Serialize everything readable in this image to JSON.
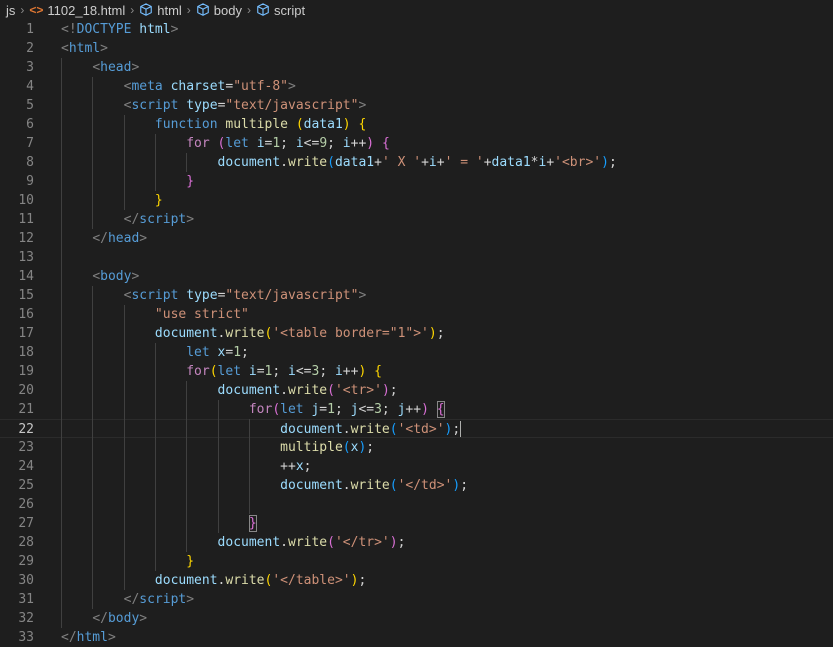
{
  "breadcrumb": {
    "folder": "js",
    "file": "1102_18.html",
    "html": "html",
    "body": "body",
    "script": "script"
  },
  "colors": {
    "background": "#1e1e1e",
    "tag": "#569cd6",
    "attribute": "#9cdcfe",
    "string": "#ce9178",
    "keyword_control": "#c586c0",
    "function": "#dcdcaa",
    "number": "#b5cea8",
    "line_number": "#858585"
  },
  "editor": {
    "active_line": 22,
    "lines": [
      {
        "n": "1",
        "tokens": [
          [
            "t-punc",
            "<!"
          ],
          [
            "t-tag",
            "DOCTYPE"
          ],
          [
            "t-op",
            " "
          ],
          [
            "t-attr",
            "html"
          ],
          [
            "t-punc",
            ">"
          ]
        ]
      },
      {
        "n": "2",
        "tokens": [
          [
            "t-punc",
            "<"
          ],
          [
            "t-tag",
            "html"
          ],
          [
            "t-punc",
            ">"
          ]
        ]
      },
      {
        "n": "3",
        "tokens": [
          [
            "t-op",
            "    "
          ],
          [
            "t-punc",
            "<"
          ],
          [
            "t-tag",
            "head"
          ],
          [
            "t-punc",
            ">"
          ]
        ]
      },
      {
        "n": "4",
        "tokens": [
          [
            "t-op",
            "        "
          ],
          [
            "t-punc",
            "<"
          ],
          [
            "t-tag",
            "meta"
          ],
          [
            "t-op",
            " "
          ],
          [
            "t-attr",
            "charset"
          ],
          [
            "t-op",
            "="
          ],
          [
            "t-str",
            "\"utf-8\""
          ],
          [
            "t-punc",
            ">"
          ]
        ]
      },
      {
        "n": "5",
        "tokens": [
          [
            "t-op",
            "        "
          ],
          [
            "t-punc",
            "<"
          ],
          [
            "t-tag",
            "script"
          ],
          [
            "t-op",
            " "
          ],
          [
            "t-attr",
            "type"
          ],
          [
            "t-op",
            "="
          ],
          [
            "t-str",
            "\"text/javascript\""
          ],
          [
            "t-punc",
            ">"
          ]
        ]
      },
      {
        "n": "6",
        "tokens": [
          [
            "t-op",
            "            "
          ],
          [
            "t-kw",
            "function"
          ],
          [
            "t-op",
            " "
          ],
          [
            "t-fn",
            "multiple"
          ],
          [
            "t-op",
            " "
          ],
          [
            "t-br",
            "("
          ],
          [
            "t-var",
            "data1"
          ],
          [
            "t-br",
            ")"
          ],
          [
            "t-op",
            " "
          ],
          [
            "t-br",
            "{"
          ]
        ]
      },
      {
        "n": "7",
        "tokens": [
          [
            "t-op",
            "                "
          ],
          [
            "t-ctrl",
            "for"
          ],
          [
            "t-op",
            " "
          ],
          [
            "t-br2",
            "("
          ],
          [
            "t-kw",
            "let"
          ],
          [
            "t-op",
            " "
          ],
          [
            "t-var",
            "i"
          ],
          [
            "t-op",
            "="
          ],
          [
            "t-num",
            "1"
          ],
          [
            "t-op",
            "; "
          ],
          [
            "t-var",
            "i"
          ],
          [
            "t-op",
            "<="
          ],
          [
            "t-num",
            "9"
          ],
          [
            "t-op",
            "; "
          ],
          [
            "t-var",
            "i"
          ],
          [
            "t-op",
            "++"
          ],
          [
            "t-br2",
            ")"
          ],
          [
            "t-op",
            " "
          ],
          [
            "t-br2",
            "{"
          ]
        ]
      },
      {
        "n": "8",
        "tokens": [
          [
            "t-op",
            "                    "
          ],
          [
            "t-var",
            "document"
          ],
          [
            "t-op",
            "."
          ],
          [
            "t-fn",
            "write"
          ],
          [
            "t-br3",
            "("
          ],
          [
            "t-var",
            "data1"
          ],
          [
            "t-op",
            "+"
          ],
          [
            "t-str",
            "' X '"
          ],
          [
            "t-op",
            "+"
          ],
          [
            "t-var",
            "i"
          ],
          [
            "t-op",
            "+"
          ],
          [
            "t-str",
            "' = '"
          ],
          [
            "t-op",
            "+"
          ],
          [
            "t-var",
            "data1"
          ],
          [
            "t-op",
            "*"
          ],
          [
            "t-var",
            "i"
          ],
          [
            "t-op",
            "+"
          ],
          [
            "t-str",
            "'<br>'"
          ],
          [
            "t-br3",
            ")"
          ],
          [
            "t-op",
            ";"
          ]
        ]
      },
      {
        "n": "9",
        "tokens": [
          [
            "t-op",
            "                "
          ],
          [
            "t-br2",
            "}"
          ]
        ]
      },
      {
        "n": "10",
        "tokens": [
          [
            "t-op",
            "            "
          ],
          [
            "t-br",
            "}"
          ]
        ]
      },
      {
        "n": "11",
        "tokens": [
          [
            "t-op",
            "        "
          ],
          [
            "t-punc",
            "</"
          ],
          [
            "t-tag",
            "script"
          ],
          [
            "t-punc",
            ">"
          ]
        ]
      },
      {
        "n": "12",
        "tokens": [
          [
            "t-op",
            "    "
          ],
          [
            "t-punc",
            "</"
          ],
          [
            "t-tag",
            "head"
          ],
          [
            "t-punc",
            ">"
          ]
        ]
      },
      {
        "n": "13",
        "tokens": []
      },
      {
        "n": "14",
        "tokens": [
          [
            "t-op",
            "    "
          ],
          [
            "t-punc",
            "<"
          ],
          [
            "t-tag",
            "body"
          ],
          [
            "t-punc",
            ">"
          ]
        ]
      },
      {
        "n": "15",
        "tokens": [
          [
            "t-op",
            "        "
          ],
          [
            "t-punc",
            "<"
          ],
          [
            "t-tag",
            "script"
          ],
          [
            "t-op",
            " "
          ],
          [
            "t-attr",
            "type"
          ],
          [
            "t-op",
            "="
          ],
          [
            "t-str",
            "\"text/javascript\""
          ],
          [
            "t-punc",
            ">"
          ]
        ]
      },
      {
        "n": "16",
        "tokens": [
          [
            "t-op",
            "            "
          ],
          [
            "t-str",
            "\"use strict\""
          ]
        ]
      },
      {
        "n": "17",
        "tokens": [
          [
            "t-op",
            "            "
          ],
          [
            "t-var",
            "document"
          ],
          [
            "t-op",
            "."
          ],
          [
            "t-fn",
            "write"
          ],
          [
            "t-br",
            "("
          ],
          [
            "t-str",
            "'<table border=\"1\">'"
          ],
          [
            "t-br",
            ")"
          ],
          [
            "t-op",
            ";"
          ]
        ]
      },
      {
        "n": "18",
        "tokens": [
          [
            "t-op",
            "                "
          ],
          [
            "t-kw",
            "let"
          ],
          [
            "t-op",
            " "
          ],
          [
            "t-var",
            "x"
          ],
          [
            "t-op",
            "="
          ],
          [
            "t-num",
            "1"
          ],
          [
            "t-op",
            ";"
          ]
        ]
      },
      {
        "n": "19",
        "tokens": [
          [
            "t-op",
            "                "
          ],
          [
            "t-ctrl",
            "for"
          ],
          [
            "t-br",
            "("
          ],
          [
            "t-kw",
            "let"
          ],
          [
            "t-op",
            " "
          ],
          [
            "t-var",
            "i"
          ],
          [
            "t-op",
            "="
          ],
          [
            "t-num",
            "1"
          ],
          [
            "t-op",
            "; "
          ],
          [
            "t-var",
            "i"
          ],
          [
            "t-op",
            "<="
          ],
          [
            "t-num",
            "3"
          ],
          [
            "t-op",
            "; "
          ],
          [
            "t-var",
            "i"
          ],
          [
            "t-op",
            "++"
          ],
          [
            "t-br",
            ")"
          ],
          [
            "t-op",
            " "
          ],
          [
            "t-br",
            "{"
          ]
        ]
      },
      {
        "n": "20",
        "tokens": [
          [
            "t-op",
            "                    "
          ],
          [
            "t-var",
            "document"
          ],
          [
            "t-op",
            "."
          ],
          [
            "t-fn",
            "write"
          ],
          [
            "t-br2",
            "("
          ],
          [
            "t-str",
            "'<tr>'"
          ],
          [
            "t-br2",
            ")"
          ],
          [
            "t-op",
            ";"
          ]
        ]
      },
      {
        "n": "21",
        "tokens": [
          [
            "t-op",
            "                        "
          ],
          [
            "t-ctrl",
            "for"
          ],
          [
            "t-br2",
            "("
          ],
          [
            "t-kw",
            "let"
          ],
          [
            "t-op",
            " "
          ],
          [
            "t-var",
            "j"
          ],
          [
            "t-op",
            "="
          ],
          [
            "t-num",
            "1"
          ],
          [
            "t-op",
            "; "
          ],
          [
            "t-var",
            "j"
          ],
          [
            "t-op",
            "<="
          ],
          [
            "t-num",
            "3"
          ],
          [
            "t-op",
            "; "
          ],
          [
            "t-var",
            "j"
          ],
          [
            "t-op",
            "++"
          ],
          [
            "t-br2",
            ")"
          ],
          [
            "t-op",
            " "
          ],
          [
            "t-br2",
            "{"
          ]
        ]
      },
      {
        "n": "22",
        "tokens": [
          [
            "t-op",
            "                            "
          ],
          [
            "t-var",
            "document"
          ],
          [
            "t-op",
            "."
          ],
          [
            "t-fn",
            "write"
          ],
          [
            "t-br3",
            "("
          ],
          [
            "t-str",
            "'<td>'"
          ],
          [
            "t-br3",
            ")"
          ],
          [
            "t-op",
            ";"
          ]
        ]
      },
      {
        "n": "23",
        "tokens": [
          [
            "t-op",
            "                            "
          ],
          [
            "t-fn",
            "multiple"
          ],
          [
            "t-br3",
            "("
          ],
          [
            "t-var",
            "x"
          ],
          [
            "t-br3",
            ")"
          ],
          [
            "t-op",
            ";"
          ]
        ]
      },
      {
        "n": "24",
        "tokens": [
          [
            "t-op",
            "                            "
          ],
          [
            "t-op",
            "++"
          ],
          [
            "t-var",
            "x"
          ],
          [
            "t-op",
            ";"
          ]
        ]
      },
      {
        "n": "25",
        "tokens": [
          [
            "t-op",
            "                            "
          ],
          [
            "t-var",
            "document"
          ],
          [
            "t-op",
            "."
          ],
          [
            "t-fn",
            "write"
          ],
          [
            "t-br3",
            "("
          ],
          [
            "t-str",
            "'</td>'"
          ],
          [
            "t-br3",
            ")"
          ],
          [
            "t-op",
            ";"
          ]
        ]
      },
      {
        "n": "26",
        "tokens": []
      },
      {
        "n": "27",
        "tokens": [
          [
            "t-op",
            "                        "
          ],
          [
            "t-br2",
            "}"
          ]
        ]
      },
      {
        "n": "28",
        "tokens": [
          [
            "t-op",
            "                    "
          ],
          [
            "t-var",
            "document"
          ],
          [
            "t-op",
            "."
          ],
          [
            "t-fn",
            "write"
          ],
          [
            "t-br2",
            "("
          ],
          [
            "t-str",
            "'</tr>'"
          ],
          [
            "t-br2",
            ")"
          ],
          [
            "t-op",
            ";"
          ]
        ]
      },
      {
        "n": "29",
        "tokens": [
          [
            "t-op",
            "                "
          ],
          [
            "t-br",
            "}"
          ]
        ]
      },
      {
        "n": "30",
        "tokens": [
          [
            "t-op",
            "            "
          ],
          [
            "t-var",
            "document"
          ],
          [
            "t-op",
            "."
          ],
          [
            "t-fn",
            "write"
          ],
          [
            "t-br",
            "("
          ],
          [
            "t-str",
            "'</table>'"
          ],
          [
            "t-br",
            ")"
          ],
          [
            "t-op",
            ";"
          ]
        ]
      },
      {
        "n": "31",
        "tokens": [
          [
            "t-op",
            "        "
          ],
          [
            "t-punc",
            "</"
          ],
          [
            "t-tag",
            "script"
          ],
          [
            "t-punc",
            ">"
          ]
        ]
      },
      {
        "n": "32",
        "tokens": [
          [
            "t-op",
            "    "
          ],
          [
            "t-punc",
            "</"
          ],
          [
            "t-tag",
            "body"
          ],
          [
            "t-punc",
            ">"
          ]
        ]
      },
      {
        "n": "33",
        "tokens": [
          [
            "t-punc",
            "</"
          ],
          [
            "t-tag",
            "html"
          ],
          [
            "t-punc",
            ">"
          ]
        ]
      }
    ]
  }
}
